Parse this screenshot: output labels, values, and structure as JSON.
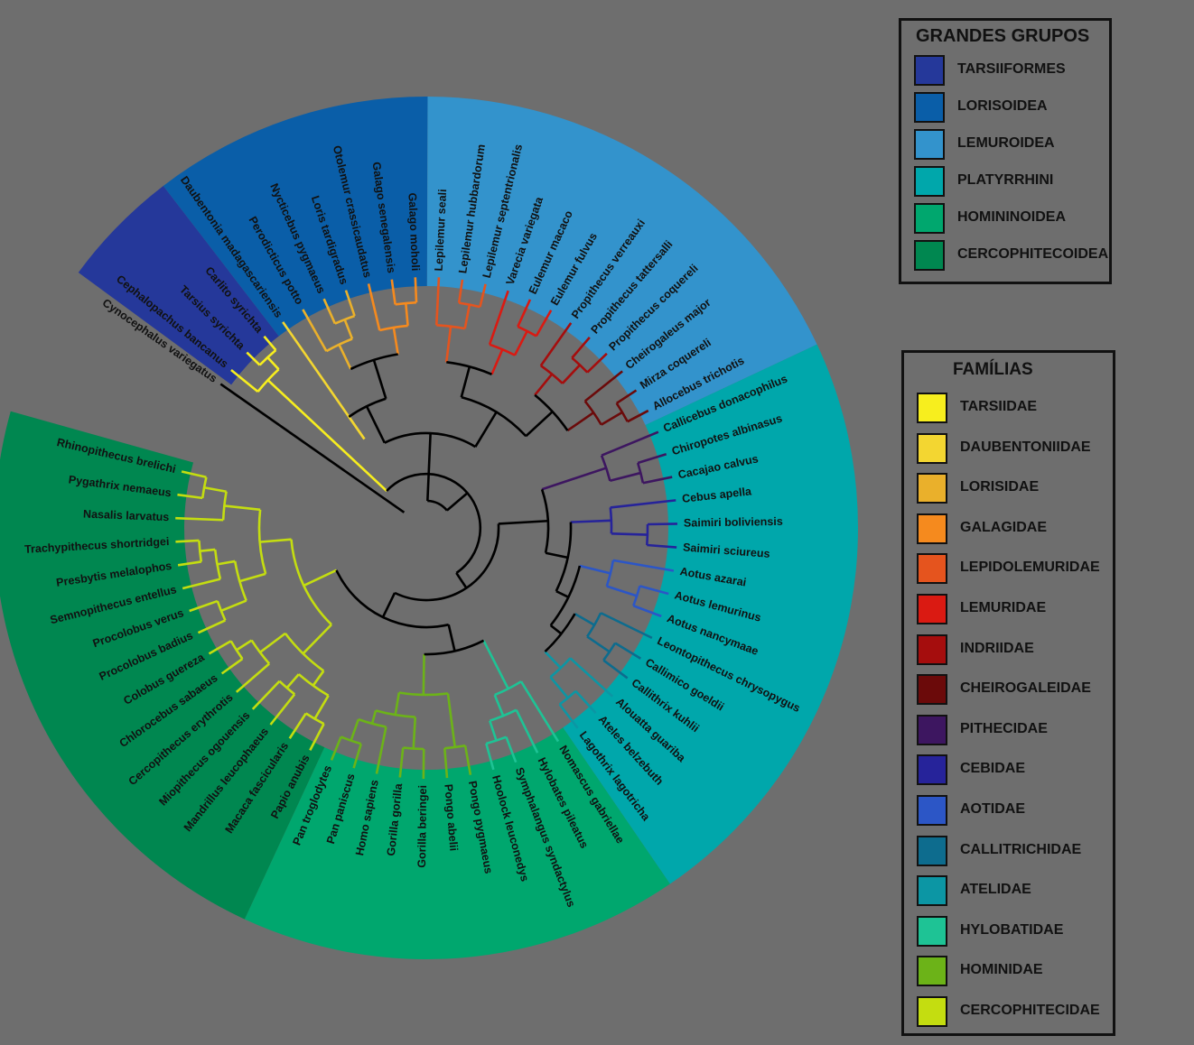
{
  "groups_legend": {
    "title": "GRANDES GRUPOS",
    "items": [
      {
        "label": "TARSIIFORMES",
        "color": "#25389a"
      },
      {
        "label": "LORISOIDEA",
        "color": "#0a5ea8"
      },
      {
        "label": "LEMUROIDEA",
        "color": "#3393cc"
      },
      {
        "label": "PLATYRRHINI",
        "color": "#00a7ab"
      },
      {
        "label": "HOMININOIDEA",
        "color": "#00a76e"
      },
      {
        "label": "CERCOPHITECOIDEA",
        "color": "#008750"
      }
    ]
  },
  "families_legend": {
    "title": "FAMÍLIAS",
    "items": [
      {
        "label": "TARSIIDAE",
        "color": "#f7ee1e"
      },
      {
        "label": "DAUBENTONIIDAE",
        "color": "#f3d631"
      },
      {
        "label": "LORISIDAE",
        "color": "#eab02b"
      },
      {
        "label": "GALAGIDAE",
        "color": "#f58a1e"
      },
      {
        "label": "LEPIDOLEMURIDAE",
        "color": "#e5541e"
      },
      {
        "label": "LEMURIDAE",
        "color": "#da1a12"
      },
      {
        "label": "INDRIIDAE",
        "color": "#a50d0d"
      },
      {
        "label": "CHEIROGALEIDAE",
        "color": "#6b0a0a"
      },
      {
        "label": "PITHECIDAE",
        "color": "#3d1660"
      },
      {
        "label": "CEBIDAE",
        "color": "#26239a"
      },
      {
        "label": "AOTIDAE",
        "color": "#2c56c6"
      },
      {
        "label": "CALLITRICHIDAE",
        "color": "#0d6c8e"
      },
      {
        "label": "ATELIDAE",
        "color": "#0c96a4"
      },
      {
        "label": "HYLOBATIDAE",
        "color": "#1ec395"
      },
      {
        "label": "HOMINIDAE",
        "color": "#6cb318"
      },
      {
        "label": "CERCOPHITECIDAE",
        "color": "#c4dd10"
      }
    ]
  },
  "outgroup": {
    "label": "Cynocephalus variegatus",
    "color": "#ffffff"
  },
  "tree": {
    "tip_groups": [
      {
        "group": "TARSIIFORMES",
        "family": "TARSIIDAE",
        "tips": [
          "Cephalopachus bancanus",
          "Tarsius syrichta",
          "Carlito syrichta"
        ]
      },
      {
        "group": "LORISOIDEA",
        "family": "DAUBENTONIIDAE",
        "tips": [
          "Daubentonia madagascariensis"
        ]
      },
      {
        "group": "LORISOIDEA",
        "family": "LORISIDAE",
        "tips": [
          "Perodicticus potto",
          "Nycticebus pygmaeus",
          "Loris tardigradus"
        ]
      },
      {
        "group": "LORISOIDEA",
        "family": "GALAGIDAE",
        "tips": [
          "Otolemur crassicaudatus",
          "Galago senegalensis",
          "Galago moholi"
        ]
      },
      {
        "group": "LEMUROIDEA",
        "family": "LEPIDOLEMURIDAE",
        "tips": [
          "Lepilemur seali",
          "Lepilemur hubbardorum",
          "Lepilemur septentrionalis"
        ]
      },
      {
        "group": "LEMUROIDEA",
        "family": "LEMURIDAE",
        "tips": [
          "Varecia variegata",
          "Eulemur macaco",
          "Eulemur fulvus"
        ]
      },
      {
        "group": "LEMUROIDEA",
        "family": "INDRIIDAE",
        "tips": [
          "Propithecus verreauxi",
          "Propithecus tattersalli",
          "Propithecus coquereli"
        ]
      },
      {
        "group": "LEMUROIDEA",
        "family": "CHEIROGALEIDAE",
        "tips": [
          "Cheirogaleus major",
          "Mirza coquereli",
          "Allocebus trichotis"
        ]
      },
      {
        "group": "PLATYRRHINI",
        "family": "PITHECIDAE",
        "tips": [
          "Callicebus donacophilus",
          "Chiropotes albinasus",
          "Cacajao calvus"
        ]
      },
      {
        "group": "PLATYRRHINI",
        "family": "CEBIDAE",
        "tips": [
          "Cebus apella",
          "Saimiri boliviensis",
          "Saimiri sciureus"
        ]
      },
      {
        "group": "PLATYRRHINI",
        "family": "AOTIDAE",
        "tips": [
          "Aotus azarai",
          "Aotus lemurinus",
          "Aotus nancymaae"
        ]
      },
      {
        "group": "PLATYRRHINI",
        "family": "CALLITRICHIDAE",
        "tips": [
          "Leontopithecus chrysopygus",
          "Callimico goeldii",
          "Callithrix kuhlii"
        ]
      },
      {
        "group": "PLATYRRHINI",
        "family": "ATELIDAE",
        "tips": [
          "Alouatta guariba",
          "Ateles belzebuth",
          "Lagothrix lagotricha"
        ]
      },
      {
        "group": "HOMININOIDEA",
        "family": "HYLOBATIDAE",
        "tips": [
          "Nomascus gabriellae",
          "Hylobates pileatus",
          "Symphalangus syndactylus",
          "Hoolock leuconedys"
        ]
      },
      {
        "group": "HOMININOIDEA",
        "family": "HOMINIDAE",
        "tips": [
          "Pongo pygmaeus",
          "Pongo abelii",
          "Gorilla beringei",
          "Gorilla gorilla",
          "Homo sapiens",
          "Pan paniscus",
          "Pan troglodytes"
        ]
      },
      {
        "group": "CERCOPHITECOIDEA",
        "family": "CERCOPHITECIDAE",
        "tips": [
          "Papio anubis",
          "Macaca fascicularis",
          "Mandrillus leucophaeus",
          "Miopithecus ogouensis",
          "Cercopithecus erythrotis",
          "Chlorocebus sabaeus",
          "Colobus guereza",
          "Procolobus badius",
          "Procolobus verus",
          "Semnopithecus entellus",
          "Presbytis melalophos",
          "Trachypithecus shortridgei",
          "Nasalis larvatus",
          "Pygathrix nemaeus",
          "Rhinopithecus brelichi"
        ]
      }
    ]
  }
}
